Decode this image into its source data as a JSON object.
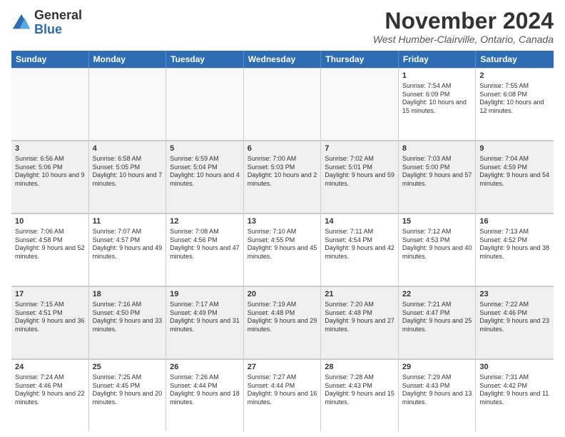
{
  "logo": {
    "general": "General",
    "blue": "Blue"
  },
  "title": "November 2024",
  "location": "West Humber-Clairville, Ontario, Canada",
  "header_days": [
    "Sunday",
    "Monday",
    "Tuesday",
    "Wednesday",
    "Thursday",
    "Friday",
    "Saturday"
  ],
  "rows": [
    [
      {
        "day": "",
        "info": "",
        "empty": true
      },
      {
        "day": "",
        "info": "",
        "empty": true
      },
      {
        "day": "",
        "info": "",
        "empty": true
      },
      {
        "day": "",
        "info": "",
        "empty": true
      },
      {
        "day": "",
        "info": "",
        "empty": true
      },
      {
        "day": "1",
        "info": "Sunrise: 7:54 AM\nSunset: 6:09 PM\nDaylight: 10 hours and 15 minutes."
      },
      {
        "day": "2",
        "info": "Sunrise: 7:55 AM\nSunset: 6:08 PM\nDaylight: 10 hours and 12 minutes."
      }
    ],
    [
      {
        "day": "3",
        "info": "Sunrise: 6:56 AM\nSunset: 5:06 PM\nDaylight: 10 hours and 9 minutes."
      },
      {
        "day": "4",
        "info": "Sunrise: 6:58 AM\nSunset: 5:05 PM\nDaylight: 10 hours and 7 minutes."
      },
      {
        "day": "5",
        "info": "Sunrise: 6:59 AM\nSunset: 5:04 PM\nDaylight: 10 hours and 4 minutes."
      },
      {
        "day": "6",
        "info": "Sunrise: 7:00 AM\nSunset: 5:03 PM\nDaylight: 10 hours and 2 minutes."
      },
      {
        "day": "7",
        "info": "Sunrise: 7:02 AM\nSunset: 5:01 PM\nDaylight: 9 hours and 59 minutes."
      },
      {
        "day": "8",
        "info": "Sunrise: 7:03 AM\nSunset: 5:00 PM\nDaylight: 9 hours and 57 minutes."
      },
      {
        "day": "9",
        "info": "Sunrise: 7:04 AM\nSunset: 4:59 PM\nDaylight: 9 hours and 54 minutes."
      }
    ],
    [
      {
        "day": "10",
        "info": "Sunrise: 7:06 AM\nSunset: 4:58 PM\nDaylight: 9 hours and 52 minutes."
      },
      {
        "day": "11",
        "info": "Sunrise: 7:07 AM\nSunset: 4:57 PM\nDaylight: 9 hours and 49 minutes."
      },
      {
        "day": "12",
        "info": "Sunrise: 7:08 AM\nSunset: 4:56 PM\nDaylight: 9 hours and 47 minutes."
      },
      {
        "day": "13",
        "info": "Sunrise: 7:10 AM\nSunset: 4:55 PM\nDaylight: 9 hours and 45 minutes."
      },
      {
        "day": "14",
        "info": "Sunrise: 7:11 AM\nSunset: 4:54 PM\nDaylight: 9 hours and 42 minutes."
      },
      {
        "day": "15",
        "info": "Sunrise: 7:12 AM\nSunset: 4:53 PM\nDaylight: 9 hours and 40 minutes."
      },
      {
        "day": "16",
        "info": "Sunrise: 7:13 AM\nSunset: 4:52 PM\nDaylight: 9 hours and 38 minutes."
      }
    ],
    [
      {
        "day": "17",
        "info": "Sunrise: 7:15 AM\nSunset: 4:51 PM\nDaylight: 9 hours and 36 minutes."
      },
      {
        "day": "18",
        "info": "Sunrise: 7:16 AM\nSunset: 4:50 PM\nDaylight: 9 hours and 33 minutes."
      },
      {
        "day": "19",
        "info": "Sunrise: 7:17 AM\nSunset: 4:49 PM\nDaylight: 9 hours and 31 minutes."
      },
      {
        "day": "20",
        "info": "Sunrise: 7:19 AM\nSunset: 4:48 PM\nDaylight: 9 hours and 29 minutes."
      },
      {
        "day": "21",
        "info": "Sunrise: 7:20 AM\nSunset: 4:48 PM\nDaylight: 9 hours and 27 minutes."
      },
      {
        "day": "22",
        "info": "Sunrise: 7:21 AM\nSunset: 4:47 PM\nDaylight: 9 hours and 25 minutes."
      },
      {
        "day": "23",
        "info": "Sunrise: 7:22 AM\nSunset: 4:46 PM\nDaylight: 9 hours and 23 minutes."
      }
    ],
    [
      {
        "day": "24",
        "info": "Sunrise: 7:24 AM\nSunset: 4:46 PM\nDaylight: 9 hours and 22 minutes."
      },
      {
        "day": "25",
        "info": "Sunrise: 7:25 AM\nSunset: 4:45 PM\nDaylight: 9 hours and 20 minutes."
      },
      {
        "day": "26",
        "info": "Sunrise: 7:26 AM\nSunset: 4:44 PM\nDaylight: 9 hours and 18 minutes."
      },
      {
        "day": "27",
        "info": "Sunrise: 7:27 AM\nSunset: 4:44 PM\nDaylight: 9 hours and 16 minutes."
      },
      {
        "day": "28",
        "info": "Sunrise: 7:28 AM\nSunset: 4:43 PM\nDaylight: 9 hours and 15 minutes."
      },
      {
        "day": "29",
        "info": "Sunrise: 7:29 AM\nSunset: 4:43 PM\nDaylight: 9 hours and 13 minutes."
      },
      {
        "day": "30",
        "info": "Sunrise: 7:31 AM\nSunset: 4:42 PM\nDaylight: 9 hours and 11 minutes."
      }
    ]
  ]
}
